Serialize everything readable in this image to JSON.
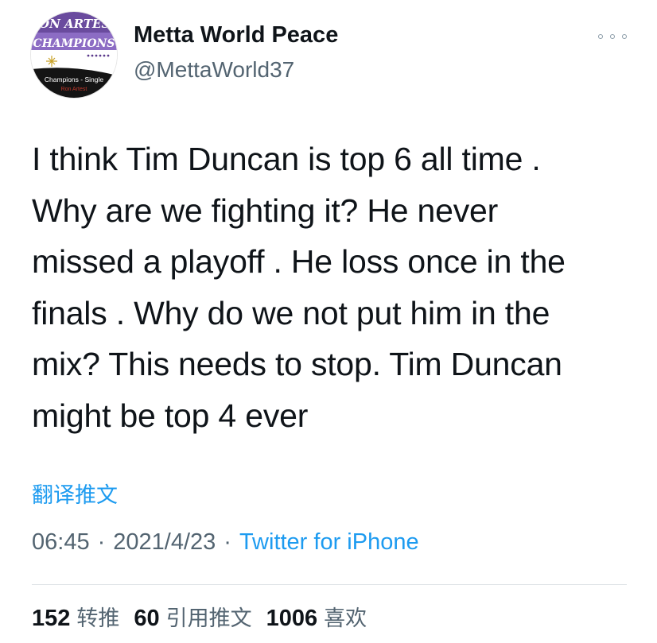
{
  "author": {
    "name": "Metta World Peace",
    "handle": "@MettaWorld37",
    "avatar": {
      "title_line1": "RON ARTEST",
      "title_line2": "CHAMPIONS",
      "caption": "Champions - Single",
      "sub_caption": "Ron Artest"
    }
  },
  "tweet": {
    "lines": [
      "I think Tim Duncan is top 6 all time .",
      "Why are we fighting it? He never",
      "missed a playoff . He loss once in the",
      "finals . Why do we not put him in the",
      "mix? This needs to stop. Tim Duncan",
      "might be top 4 ever"
    ],
    "translate_label": "翻译推文",
    "time": "06:45",
    "date": "2021/4/23",
    "separator": "·",
    "source": "Twitter for iPhone"
  },
  "stats": {
    "retweets": {
      "count": "152",
      "label": "转推"
    },
    "quotes": {
      "count": "60",
      "label": "引用推文"
    },
    "likes": {
      "count": "1006",
      "label": "喜欢"
    }
  },
  "colors": {
    "text": "#0f1419",
    "secondary": "#536471",
    "link": "#1d9bf0",
    "avatar_purple": "#5b3a8c"
  },
  "icons": {
    "more": "more-horizontal-icon"
  }
}
